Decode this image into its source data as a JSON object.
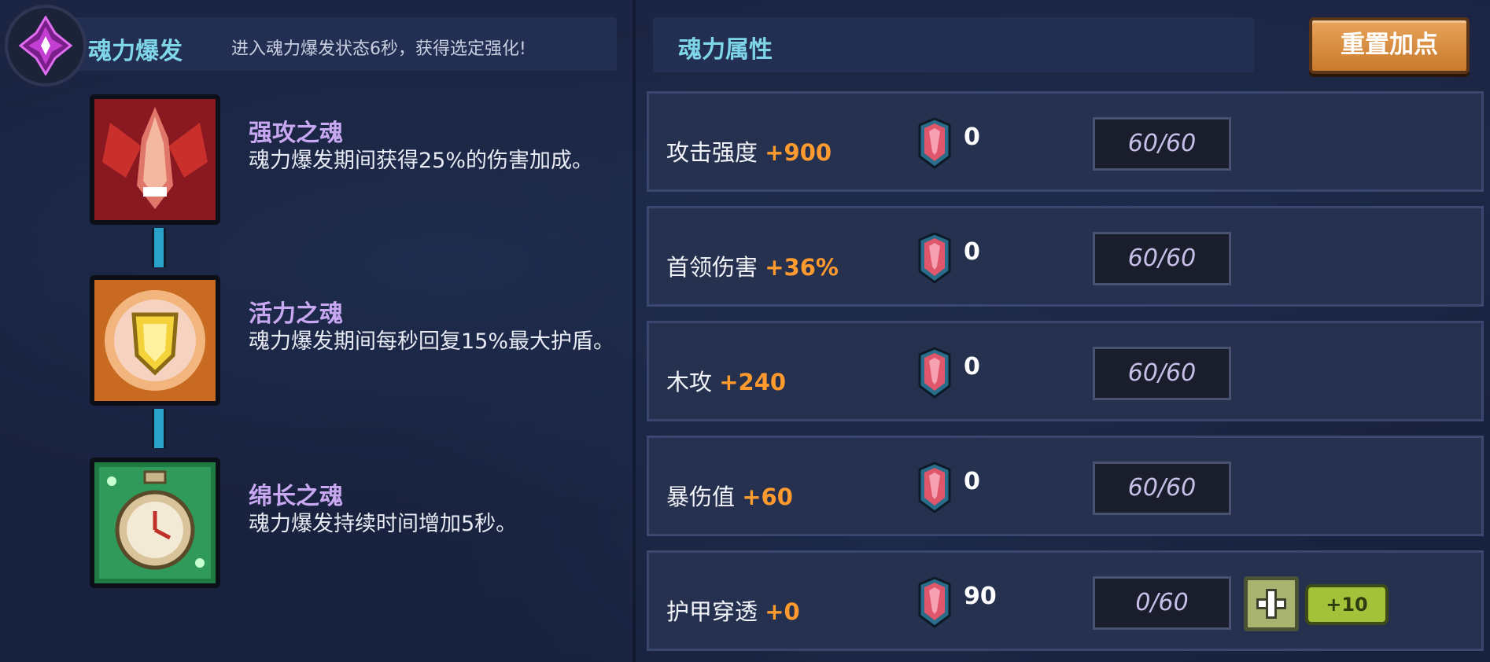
{
  "soul_burst": {
    "title": "魂力爆发",
    "description": "进入魂力爆发状态6秒，获得选定强化!"
  },
  "skills": [
    {
      "name": "强攻之魂",
      "description": "魂力爆发期间获得25%的伤害加成。",
      "icon": "red-attack-soul-icon",
      "color": "#b8262c"
    },
    {
      "name": "活力之魂",
      "description": "魂力爆发期间每秒回复15%最大护盾。",
      "icon": "golden-shield-soul-icon",
      "color": "#e79a3a"
    },
    {
      "name": "绵长之魂",
      "description": "魂力爆发持续时间增加5秒。",
      "icon": "green-stopwatch-soul-icon",
      "color": "#3fbf6a"
    }
  ],
  "soul_attributes": {
    "title": "魂力属性",
    "reset_label": "重置加点"
  },
  "stats": [
    {
      "label": "攻击强度",
      "bonus": "+900",
      "gems": "0",
      "progress": "60/60"
    },
    {
      "label": "首领伤害",
      "bonus": "+36%",
      "gems": "0",
      "progress": "60/60"
    },
    {
      "label": "木攻",
      "bonus": "+240",
      "gems": "0",
      "progress": "60/60"
    },
    {
      "label": "暴伤值",
      "bonus": "+60",
      "gems": "0",
      "progress": "60/60"
    },
    {
      "label": "护甲穿透",
      "bonus": "+0",
      "gems": "90",
      "progress": "0/60",
      "add_label": "+10"
    }
  ],
  "colors": {
    "accent_title": "#7fd6e8",
    "bonus": "#ff9a2e",
    "reset_button": "#d98a3c",
    "plus10_button": "#a3c23a"
  }
}
